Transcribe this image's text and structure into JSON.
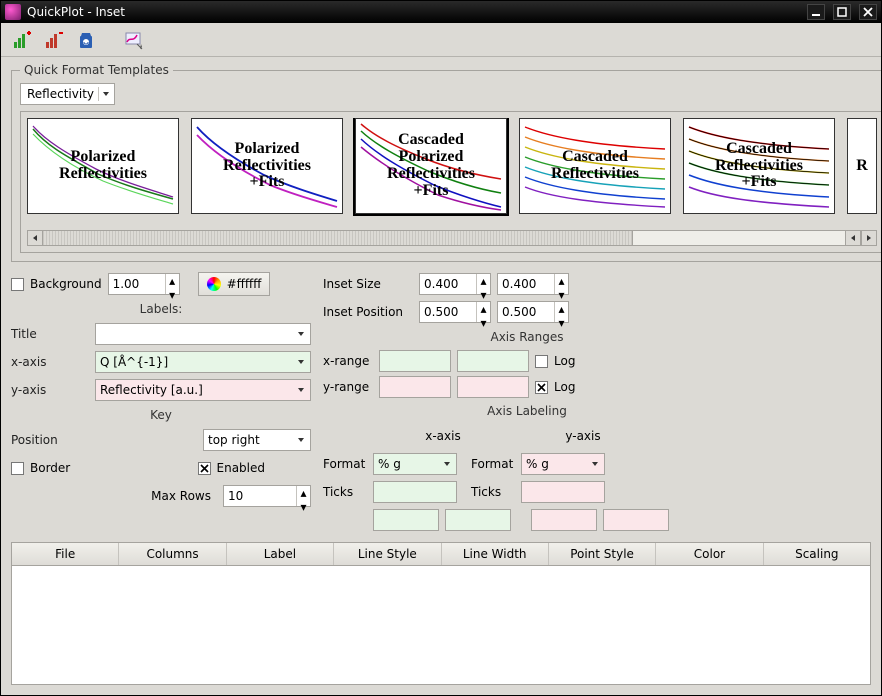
{
  "window": {
    "title": "QuickPlot - Inset"
  },
  "templates": {
    "legend": "Quick Format Templates",
    "category": "Reflectivity",
    "thumbs": [
      {
        "label": "Polarized\nReflectivities"
      },
      {
        "label": "Polarized\nReflectivities\n+Fits"
      },
      {
        "label": "Cascaded\nPolarized\nReflectivities\n+Fits"
      },
      {
        "label": "Cascaded\nReflectivities"
      },
      {
        "label": "Cascaded\nReflectivities\n+Fits"
      },
      {
        "label": "R"
      }
    ]
  },
  "background": {
    "checkbox_label": "Background",
    "opacity": "1.00",
    "color": "#ffffff"
  },
  "labels_heading": "Labels:",
  "title_row": {
    "label": "Title",
    "value": ""
  },
  "x_axis_row": {
    "label": "x-axis",
    "value": "Q [Å^{-1}]"
  },
  "y_axis_row": {
    "label": "y-axis",
    "value": "Reflectivity [a.u.]"
  },
  "key_heading": "Key",
  "position_row": {
    "label": "Position",
    "value": "top right"
  },
  "border_label": "Border",
  "enabled_label": "Enabled",
  "maxrows_row": {
    "label": "Max Rows",
    "value": "10"
  },
  "inset_size_label": "Inset Size",
  "inset_size": {
    "w": "0.400",
    "h": "0.400"
  },
  "inset_pos_label": "Inset Position",
  "inset_pos": {
    "x": "0.500",
    "y": "0.500"
  },
  "axis_ranges_heading": "Axis Ranges",
  "xrange_label": "x-range",
  "yrange_label": "y-range",
  "log_label": "Log",
  "axis_labeling_heading": "Axis Labeling",
  "xaxis_col_label": "x-axis",
  "yaxis_col_label": "y-axis",
  "format_label": "Format",
  "format_x": "% g",
  "format_y": "% g",
  "ticks_label": "Ticks",
  "table_headers": [
    "File",
    "Columns",
    "Label",
    "Line Style",
    "Line Width",
    "Point Style",
    "Color",
    "Scaling"
  ]
}
